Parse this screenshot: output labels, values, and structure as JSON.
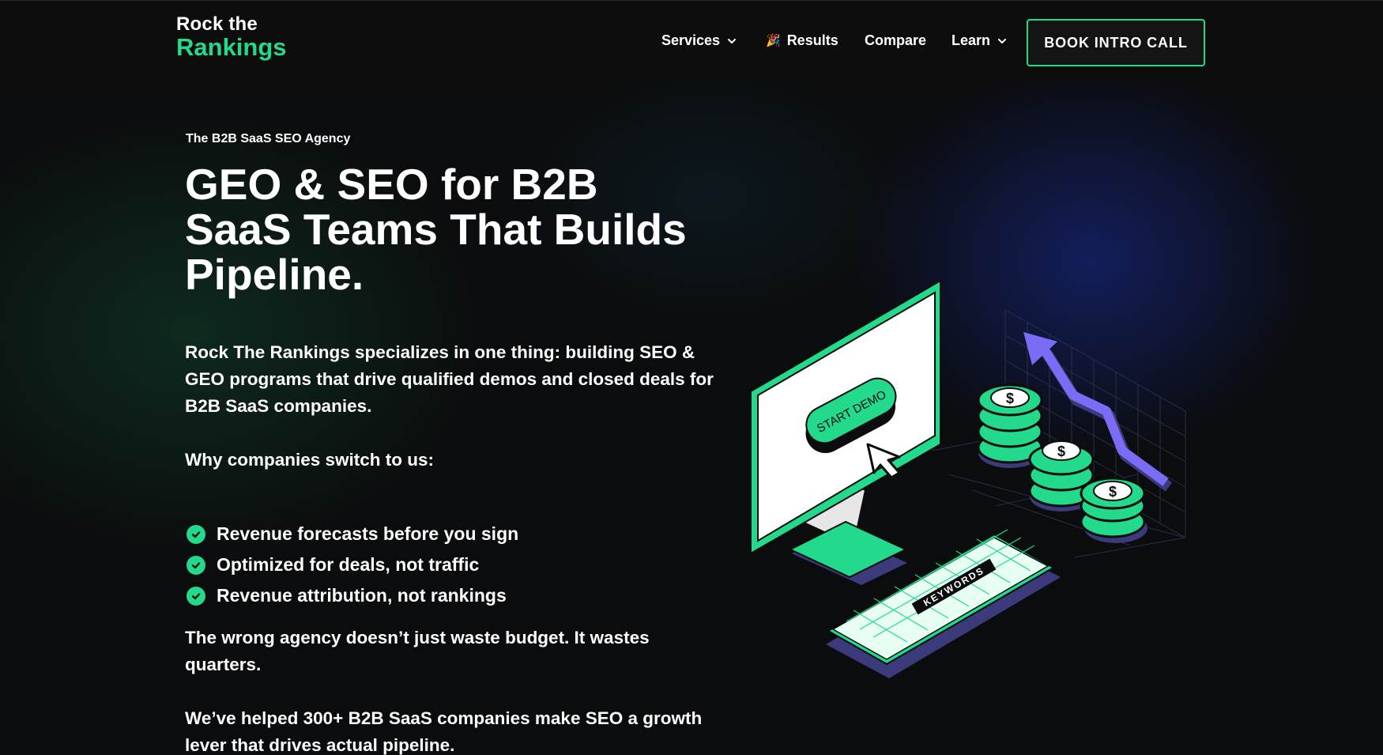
{
  "header": {
    "logo": {
      "line1": "Rock the",
      "line2": "Rankings"
    },
    "nav": [
      {
        "label": "Services",
        "has_dropdown": true,
        "icon": "chevron-down-icon"
      },
      {
        "label": "Results",
        "has_dropdown": false,
        "icon": "party-popper-icon",
        "glyph": "🎉"
      },
      {
        "label": "Compare",
        "has_dropdown": false
      },
      {
        "label": "Learn",
        "has_dropdown": true,
        "icon": "chevron-down-icon"
      }
    ],
    "cta_label": "BOOK INTRO CALL"
  },
  "hero": {
    "eyebrow": "The B2B SaaS SEO Agency",
    "headline": "GEO & SEO for B2B SaaS Teams That Builds Pipeline.",
    "intro": "Rock The Rankings specializes in one thing: building SEO & GEO programs that drive qualified demos and closed deals for B2B SaaS companies.",
    "why_heading": "Why companies switch to us:",
    "benefits": [
      "Revenue forecasts before you sign",
      "Optimized for deals, not traffic",
      "Revenue attribution, not rankings"
    ],
    "warning": "The wrong agency doesn’t just waste budget. It wastes quarters.",
    "proof": "We’ve helped 300+ B2B SaaS companies make SEO a growth lever that drives actual pipeline."
  },
  "illustration": {
    "button_text": "START DEMO",
    "keyboard_text": "KEYWORDS",
    "coin_symbol": "$"
  },
  "colors": {
    "accent": "#23d98c",
    "background": "#0b0c0d",
    "arrow": "#7b6cf5",
    "shadow": "#3b3a7a"
  }
}
